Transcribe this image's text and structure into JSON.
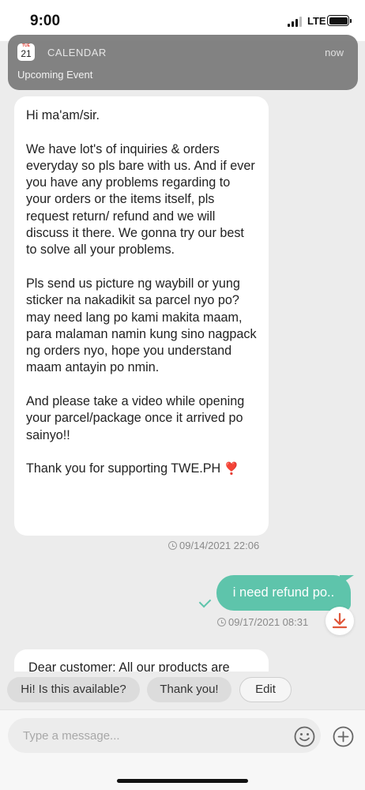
{
  "status_bar": {
    "time": "9:00",
    "network": "LTE"
  },
  "notification": {
    "icon_month": "TUE",
    "icon_day": "21",
    "app": "CALENDAR",
    "time": "now",
    "body": "Upcoming Event"
  },
  "messages": {
    "incoming": {
      "paragraphs": [
        "Hi ma'am/sir.",
        "We have lot's of inquiries & orders everyday so pls bare with us. And if ever you have any problems regarding to your orders or the items itself, pls request return/ refund and we will discuss it there. We gonna try our best to solve all your problems.",
        "Pls send us picture ng waybill or yung sticker na nakadikit sa parcel nyo po? may need lang po kami makita maam, para malaman namin kung sino nagpack ng orders nyo, hope you understand maam antayin po nmin.",
        "And please take a video while opening your parcel/package once it arrived po sainyo!!",
        "Thank you for supporting TWE.PH"
      ],
      "heart": "❣️",
      "timestamp": "09/14/2021 22:06"
    },
    "outgoing": {
      "text": "i need refund po..",
      "timestamp": "09/17/2021 08:31"
    },
    "partial": {
      "text": "Dear customer: All our products are"
    }
  },
  "quick_replies": [
    "Hi! Is this available?",
    "Thank you!",
    "Edit"
  ],
  "composer": {
    "placeholder": "Type a message...",
    "emoji_icon": "smiley-icon",
    "plus_icon": "plus-circle-icon"
  },
  "colors": {
    "accent": "#5ec4ab",
    "download": "#e0573a"
  }
}
